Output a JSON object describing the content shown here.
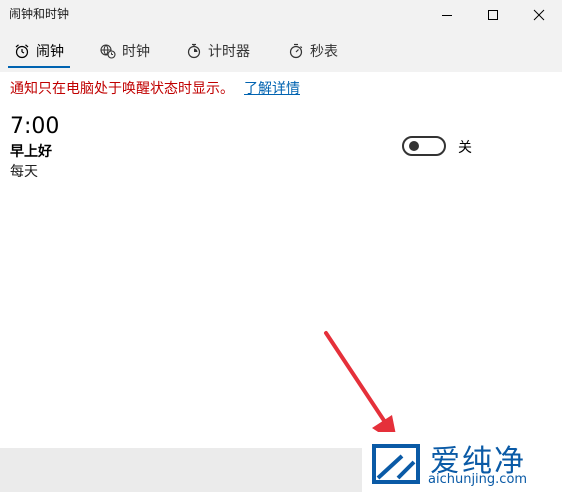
{
  "window": {
    "title": "闹钟和时钟",
    "controls": [
      "minimize",
      "maximize",
      "close"
    ]
  },
  "tabs": [
    {
      "label": "闹钟",
      "icon": "alarm-clock-icon",
      "active": true
    },
    {
      "label": "时钟",
      "icon": "world-clock-icon",
      "active": false
    },
    {
      "label": "计时器",
      "icon": "timer-icon",
      "active": false
    },
    {
      "label": "秒表",
      "icon": "stopwatch-icon",
      "active": false
    }
  ],
  "notice": {
    "text": "通知只在电脑处于唤醒状态时显示。",
    "link": "了解详情"
  },
  "alarm": {
    "time": "7:00",
    "name": "早上好",
    "repeat": "每天",
    "toggle_state": "off",
    "toggle_label": "关"
  },
  "colors": {
    "accent": "#0063b1",
    "notice": "#c00000",
    "arrow": "#e5303a"
  },
  "watermark": {
    "brand": "爱纯净",
    "url": "aichunjing.com"
  }
}
